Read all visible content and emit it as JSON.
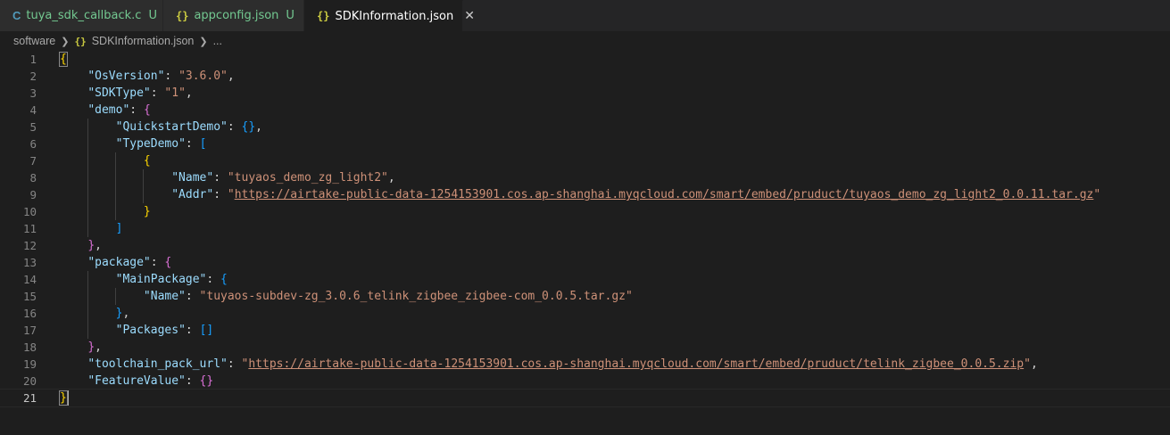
{
  "tabs": [
    {
      "icon": "C",
      "label": "tuya_sdk_callback.c",
      "status": "U",
      "active": false
    },
    {
      "icon": "{}",
      "label": "appconfig.json",
      "status": "U",
      "active": false
    },
    {
      "icon": "{}",
      "label": "SDKInformation.json",
      "status": "",
      "active": true,
      "close": "✕"
    }
  ],
  "breadcrumb": {
    "folder": "software",
    "file_icon": "{}",
    "file": "SDKInformation.json",
    "ellipsis": "..."
  },
  "editor": {
    "current_line": 21,
    "lines": [
      {
        "n": "1"
      },
      {
        "n": "2"
      },
      {
        "n": "3"
      },
      {
        "n": "4"
      },
      {
        "n": "5"
      },
      {
        "n": "6"
      },
      {
        "n": "7"
      },
      {
        "n": "8"
      },
      {
        "n": "9"
      },
      {
        "n": "10"
      },
      {
        "n": "11"
      },
      {
        "n": "12"
      },
      {
        "n": "13"
      },
      {
        "n": "14"
      },
      {
        "n": "15"
      },
      {
        "n": "16"
      },
      {
        "n": "17"
      },
      {
        "n": "18"
      },
      {
        "n": "19"
      },
      {
        "n": "20"
      },
      {
        "n": "21"
      }
    ],
    "tokens": {
      "l1_brace": "{",
      "l2_key": "\"OsVersion\"",
      "l2_val": "\"3.6.0\"",
      "l3_key": "\"SDKType\"",
      "l3_val": "\"1\"",
      "l4_key": "\"demo\"",
      "l4_brace": "{",
      "l5_key": "\"QuickstartDemo\"",
      "l5_val": "{}",
      "l6_key": "\"TypeDemo\"",
      "l6_bracket": "[",
      "l7_brace": "{",
      "l8_key": "\"Name\"",
      "l8_val": "\"tuyaos_demo_zg_light2\"",
      "l9_key": "\"Addr\"",
      "l9_q1": "\"",
      "l9_url": "https://airtake-public-data-1254153901.cos.ap-shanghai.myqcloud.com/smart/embed/pruduct/tuyaos_demo_zg_light2_0.0.11.tar.gz",
      "l9_q2": "\"",
      "l10_brace": "}",
      "l11_bracket": "]",
      "l12_brace": "}",
      "l13_key": "\"package\"",
      "l13_brace": "{",
      "l14_key": "\"MainPackage\"",
      "l14_brace": "{",
      "l15_key": "\"Name\"",
      "l15_val": "\"tuyaos-subdev-zg_3.0.6_telink_zigbee_zigbee-com_0.0.5.tar.gz\"",
      "l16_brace": "}",
      "l17_key": "\"Packages\"",
      "l17_val": "[]",
      "l18_brace": "}",
      "l19_key": "\"toolchain_pack_url\"",
      "l19_q1": "\"",
      "l19_url": "https://airtake-public-data-1254153901.cos.ap-shanghai.myqcloud.com/smart/embed/pruduct/telink_zigbee_0.0.5.zip",
      "l19_q2": "\"",
      "l20_key": "\"FeatureValue\"",
      "l20_val": "{}",
      "l21_brace": "}"
    }
  }
}
